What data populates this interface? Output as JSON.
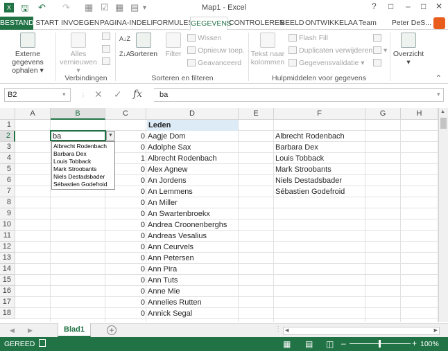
{
  "titlebar": {
    "title": "Map1 - Excel"
  },
  "ribbon_tabs": [
    "BESTAND",
    "START",
    "INVOEGEN",
    "PAGINA-INDELI",
    "FORMULES",
    "GEGEVENS",
    "CONTROLEREN",
    "BEELD",
    "ONTWIKKELAA",
    "Team"
  ],
  "user": "Peter DeS...",
  "ribbon": {
    "external_data": "Externe gegevens ophalen",
    "refresh_all": "Alles vernieuwen",
    "sort": "Sorteren",
    "filter": "Filter",
    "clear": "Wissen",
    "reapply": "Opnieuw toep.",
    "advanced": "Geavanceerd",
    "text_to_columns": "Tekst naar kolommen",
    "flash_fill": "Flash Fill",
    "remove_duplicates": "Duplicaten verwijderen",
    "data_validation": "Gegevensvalidatie",
    "outline": "Overzicht",
    "group_connections": "Verbindingen",
    "group_sort_filter": "Sorteren en filteren",
    "group_data_tools": "Hulpmiddelen voor gegevens"
  },
  "formula_bar": {
    "name_box": "B2",
    "formula": "ba"
  },
  "columns": [
    "A",
    "B",
    "C",
    "D",
    "E",
    "F",
    "G",
    "H"
  ],
  "rows": [
    "1",
    "2",
    "3",
    "4",
    "5",
    "6",
    "7",
    "8",
    "9",
    "10",
    "11",
    "12",
    "13",
    "14",
    "15",
    "16",
    "17",
    "18"
  ],
  "cells": {
    "D1": "Leden",
    "B2": "ba",
    "C": [
      "0",
      "0",
      "1",
      "0",
      "0",
      "0",
      "0",
      "0",
      "0",
      "0",
      "0",
      "0",
      "0",
      "0",
      "0",
      "0",
      "0"
    ],
    "D": [
      "Aagje Dom",
      "Adolphe Sax",
      "Albrecht Rodenbach",
      "Alex Agnew",
      "An Jordens",
      "An Lemmens",
      "An Miller",
      "An Swartenbroekx",
      "Andrea Croonenberghs",
      "Andreas Vesalius",
      "Ann Ceurvels",
      "Ann Petersen",
      "Ann Pira",
      "Ann Tuts",
      "Anne Mie",
      "Annelies Rutten",
      "Annick Segal"
    ],
    "F": [
      "Albrecht Rodenbach",
      "Barbara Dex",
      "Louis Tobback",
      "Mark Stroobants",
      "Niels Destadsbader",
      "Sébastien Godefroid"
    ]
  },
  "dropdown": [
    "Albrecht Rodenbach",
    "Barbara Dex",
    "Louis Tobback",
    "Mark Stroobants",
    "Niels Destadsbader",
    "Sébastien Godefroid"
  ],
  "sheet_tab": "Blad1",
  "status": {
    "mode": "GEREED",
    "zoom": "100%"
  },
  "colors": {
    "accent": "#217346",
    "header_highlight": "#ddebf7"
  }
}
